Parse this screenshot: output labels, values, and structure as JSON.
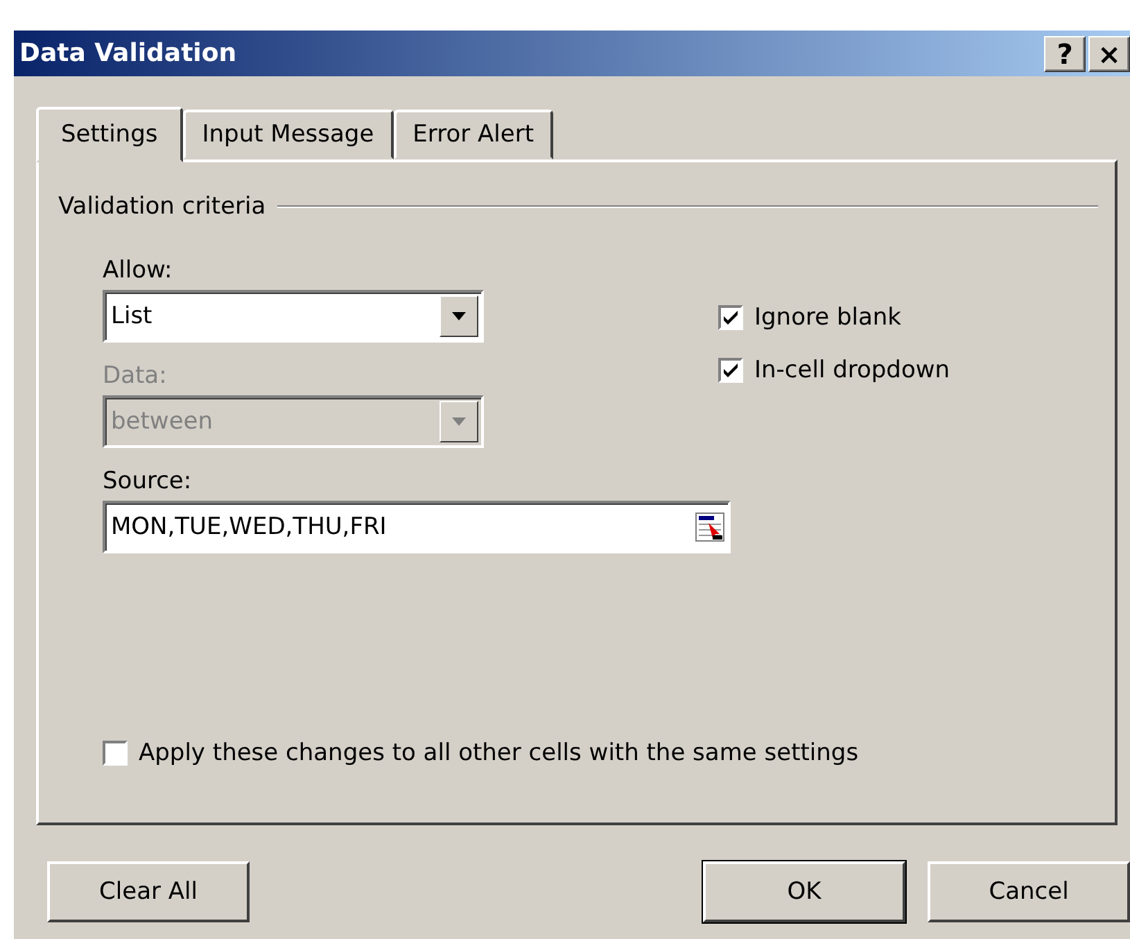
{
  "window": {
    "title": "Data Validation",
    "controls": [
      "?",
      "×"
    ]
  },
  "tabs": [
    {
      "label": "Settings",
      "selected": true
    },
    {
      "label": "Input Message",
      "selected": false
    },
    {
      "label": "Error Alert",
      "selected": false
    }
  ],
  "group": {
    "title": "Validation criteria"
  },
  "fields": [
    {
      "kind": "dropdown",
      "label": "Allow:",
      "value": "List",
      "disabled": false
    },
    {
      "kind": "dropdown",
      "label": "Data:",
      "value": "between",
      "disabled": true
    },
    {
      "kind": "range",
      "label": "Source:",
      "value": "MON,TUE,WED,THU,FRI",
      "disabled": false
    }
  ],
  "options": [
    {
      "label": "Ignore blank",
      "checked": true
    },
    {
      "label": "In-cell dropdown",
      "checked": true
    }
  ],
  "apply": {
    "label": "Apply these changes to all other cells with the same settings",
    "checked": false
  },
  "buttons": [
    {
      "label": "Clear All",
      "default": false
    },
    {
      "label": "OK",
      "default": true
    },
    {
      "label": "Cancel",
      "default": false
    }
  ]
}
